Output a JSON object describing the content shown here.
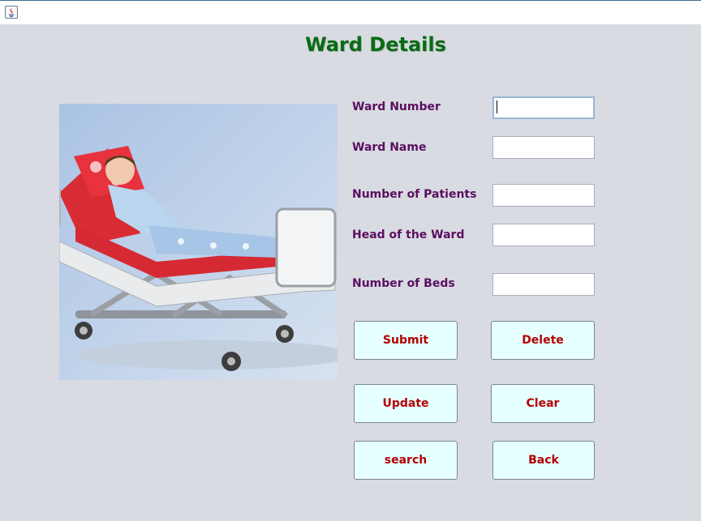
{
  "window": {
    "title": ""
  },
  "page": {
    "title": "Ward Details"
  },
  "form": {
    "fields": [
      {
        "label": "Ward Number",
        "value": ""
      },
      {
        "label": "Ward Name",
        "value": ""
      },
      {
        "label": "Number of Patients",
        "value": ""
      },
      {
        "label": "Head of the Ward",
        "value": ""
      },
      {
        "label": "Number of Beds",
        "value": ""
      }
    ]
  },
  "buttons": {
    "submit": "Submit",
    "delete": "Delete",
    "update": "Update",
    "clear": "Clear",
    "search": "search",
    "back": "Back"
  },
  "colors": {
    "background": "#d9dbe2",
    "title": "#0a6b15",
    "label": "#5a1060",
    "button_bg": "#e6ffff",
    "button_text": "#b30000"
  },
  "icons": {
    "window": "java-app-icon"
  }
}
